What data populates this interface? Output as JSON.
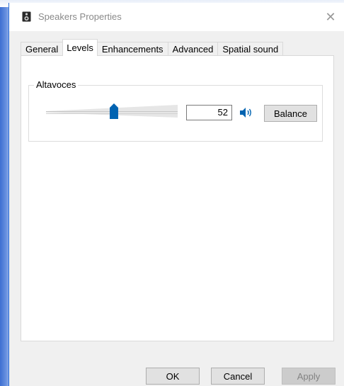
{
  "window": {
    "title": "Speakers Properties",
    "icons": {
      "app": "speaker-icon",
      "close": "close-icon"
    },
    "close_glyph": "✕"
  },
  "tabs": [
    {
      "label": "General",
      "active": false
    },
    {
      "label": "Levels",
      "active": true
    },
    {
      "label": "Enhancements",
      "active": false
    },
    {
      "label": "Advanced",
      "active": false
    },
    {
      "label": "Spatial sound",
      "active": false
    }
  ],
  "levels": {
    "device_label": "Altavoces",
    "volume": 52,
    "volume_text": "52",
    "volume_max": 100,
    "mute_icon": "speaker-volume-icon",
    "balance_label": "Balance"
  },
  "footer": {
    "ok_label": "OK",
    "cancel_label": "Cancel",
    "apply_label": "Apply",
    "apply_enabled": false
  },
  "colors": {
    "accent": "#0063b1",
    "title_text": "#8a8a8a",
    "disabled_text": "#838383"
  }
}
